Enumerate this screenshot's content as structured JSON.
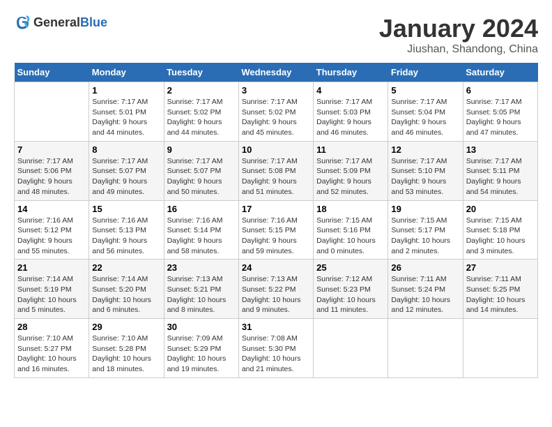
{
  "logo": {
    "general": "General",
    "blue": "Blue"
  },
  "title": "January 2024",
  "subtitle": "Jiushan, Shandong, China",
  "weekdays": [
    "Sunday",
    "Monday",
    "Tuesday",
    "Wednesday",
    "Thursday",
    "Friday",
    "Saturday"
  ],
  "weeks": [
    [
      {
        "day": "",
        "sunrise": "",
        "sunset": "",
        "daylight": ""
      },
      {
        "day": "1",
        "sunrise": "Sunrise: 7:17 AM",
        "sunset": "Sunset: 5:01 PM",
        "daylight": "Daylight: 9 hours and 44 minutes."
      },
      {
        "day": "2",
        "sunrise": "Sunrise: 7:17 AM",
        "sunset": "Sunset: 5:02 PM",
        "daylight": "Daylight: 9 hours and 44 minutes."
      },
      {
        "day": "3",
        "sunrise": "Sunrise: 7:17 AM",
        "sunset": "Sunset: 5:02 PM",
        "daylight": "Daylight: 9 hours and 45 minutes."
      },
      {
        "day": "4",
        "sunrise": "Sunrise: 7:17 AM",
        "sunset": "Sunset: 5:03 PM",
        "daylight": "Daylight: 9 hours and 46 minutes."
      },
      {
        "day": "5",
        "sunrise": "Sunrise: 7:17 AM",
        "sunset": "Sunset: 5:04 PM",
        "daylight": "Daylight: 9 hours and 46 minutes."
      },
      {
        "day": "6",
        "sunrise": "Sunrise: 7:17 AM",
        "sunset": "Sunset: 5:05 PM",
        "daylight": "Daylight: 9 hours and 47 minutes."
      }
    ],
    [
      {
        "day": "7",
        "sunrise": "Sunrise: 7:17 AM",
        "sunset": "Sunset: 5:06 PM",
        "daylight": "Daylight: 9 hours and 48 minutes."
      },
      {
        "day": "8",
        "sunrise": "Sunrise: 7:17 AM",
        "sunset": "Sunset: 5:07 PM",
        "daylight": "Daylight: 9 hours and 49 minutes."
      },
      {
        "day": "9",
        "sunrise": "Sunrise: 7:17 AM",
        "sunset": "Sunset: 5:07 PM",
        "daylight": "Daylight: 9 hours and 50 minutes."
      },
      {
        "day": "10",
        "sunrise": "Sunrise: 7:17 AM",
        "sunset": "Sunset: 5:08 PM",
        "daylight": "Daylight: 9 hours and 51 minutes."
      },
      {
        "day": "11",
        "sunrise": "Sunrise: 7:17 AM",
        "sunset": "Sunset: 5:09 PM",
        "daylight": "Daylight: 9 hours and 52 minutes."
      },
      {
        "day": "12",
        "sunrise": "Sunrise: 7:17 AM",
        "sunset": "Sunset: 5:10 PM",
        "daylight": "Daylight: 9 hours and 53 minutes."
      },
      {
        "day": "13",
        "sunrise": "Sunrise: 7:17 AM",
        "sunset": "Sunset: 5:11 PM",
        "daylight": "Daylight: 9 hours and 54 minutes."
      }
    ],
    [
      {
        "day": "14",
        "sunrise": "Sunrise: 7:16 AM",
        "sunset": "Sunset: 5:12 PM",
        "daylight": "Daylight: 9 hours and 55 minutes."
      },
      {
        "day": "15",
        "sunrise": "Sunrise: 7:16 AM",
        "sunset": "Sunset: 5:13 PM",
        "daylight": "Daylight: 9 hours and 56 minutes."
      },
      {
        "day": "16",
        "sunrise": "Sunrise: 7:16 AM",
        "sunset": "Sunset: 5:14 PM",
        "daylight": "Daylight: 9 hours and 58 minutes."
      },
      {
        "day": "17",
        "sunrise": "Sunrise: 7:16 AM",
        "sunset": "Sunset: 5:15 PM",
        "daylight": "Daylight: 9 hours and 59 minutes."
      },
      {
        "day": "18",
        "sunrise": "Sunrise: 7:15 AM",
        "sunset": "Sunset: 5:16 PM",
        "daylight": "Daylight: 10 hours and 0 minutes."
      },
      {
        "day": "19",
        "sunrise": "Sunrise: 7:15 AM",
        "sunset": "Sunset: 5:17 PM",
        "daylight": "Daylight: 10 hours and 2 minutes."
      },
      {
        "day": "20",
        "sunrise": "Sunrise: 7:15 AM",
        "sunset": "Sunset: 5:18 PM",
        "daylight": "Daylight: 10 hours and 3 minutes."
      }
    ],
    [
      {
        "day": "21",
        "sunrise": "Sunrise: 7:14 AM",
        "sunset": "Sunset: 5:19 PM",
        "daylight": "Daylight: 10 hours and 5 minutes."
      },
      {
        "day": "22",
        "sunrise": "Sunrise: 7:14 AM",
        "sunset": "Sunset: 5:20 PM",
        "daylight": "Daylight: 10 hours and 6 minutes."
      },
      {
        "day": "23",
        "sunrise": "Sunrise: 7:13 AM",
        "sunset": "Sunset: 5:21 PM",
        "daylight": "Daylight: 10 hours and 8 minutes."
      },
      {
        "day": "24",
        "sunrise": "Sunrise: 7:13 AM",
        "sunset": "Sunset: 5:22 PM",
        "daylight": "Daylight: 10 hours and 9 minutes."
      },
      {
        "day": "25",
        "sunrise": "Sunrise: 7:12 AM",
        "sunset": "Sunset: 5:23 PM",
        "daylight": "Daylight: 10 hours and 11 minutes."
      },
      {
        "day": "26",
        "sunrise": "Sunrise: 7:11 AM",
        "sunset": "Sunset: 5:24 PM",
        "daylight": "Daylight: 10 hours and 12 minutes."
      },
      {
        "day": "27",
        "sunrise": "Sunrise: 7:11 AM",
        "sunset": "Sunset: 5:25 PM",
        "daylight": "Daylight: 10 hours and 14 minutes."
      }
    ],
    [
      {
        "day": "28",
        "sunrise": "Sunrise: 7:10 AM",
        "sunset": "Sunset: 5:27 PM",
        "daylight": "Daylight: 10 hours and 16 minutes."
      },
      {
        "day": "29",
        "sunrise": "Sunrise: 7:10 AM",
        "sunset": "Sunset: 5:28 PM",
        "daylight": "Daylight: 10 hours and 18 minutes."
      },
      {
        "day": "30",
        "sunrise": "Sunrise: 7:09 AM",
        "sunset": "Sunset: 5:29 PM",
        "daylight": "Daylight: 10 hours and 19 minutes."
      },
      {
        "day": "31",
        "sunrise": "Sunrise: 7:08 AM",
        "sunset": "Sunset: 5:30 PM",
        "daylight": "Daylight: 10 hours and 21 minutes."
      },
      {
        "day": "",
        "sunrise": "",
        "sunset": "",
        "daylight": ""
      },
      {
        "day": "",
        "sunrise": "",
        "sunset": "",
        "daylight": ""
      },
      {
        "day": "",
        "sunrise": "",
        "sunset": "",
        "daylight": ""
      }
    ]
  ]
}
